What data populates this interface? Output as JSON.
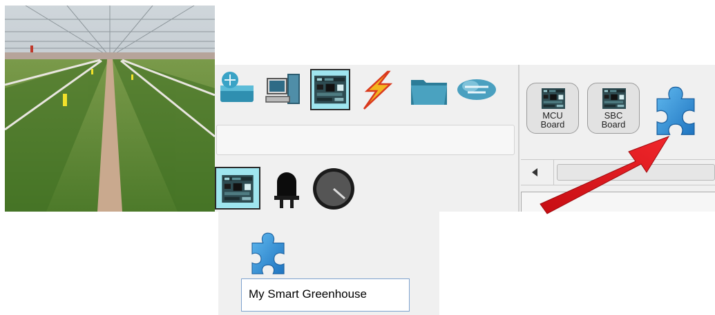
{
  "photo": {
    "name": "greenhouse-photo"
  },
  "toolbar": {
    "category_icons": [
      {
        "name": "network-devices-icon",
        "selected": false
      },
      {
        "name": "end-devices-icon",
        "selected": false
      },
      {
        "name": "components-board-icon",
        "selected": true
      },
      {
        "name": "connections-lightning-icon",
        "selected": false
      },
      {
        "name": "miscellaneous-folder-icon",
        "selected": false
      },
      {
        "name": "multiuser-cloud-icon",
        "selected": false
      }
    ],
    "search_value": "",
    "sub_icons": [
      {
        "name": "board-icon",
        "selected": true
      },
      {
        "name": "led-icon",
        "selected": false
      },
      {
        "name": "potentiometer-icon",
        "selected": false
      }
    ]
  },
  "devices": {
    "mcu_board": {
      "line1": "MCU",
      "line2": "Board"
    },
    "sbc_board": {
      "line1": "SBC",
      "line2": "Board"
    },
    "custom_icon": "puzzle-piece-icon"
  },
  "custom_device": {
    "icon": "puzzle-piece-icon",
    "name_value": "My Smart Greenhouse"
  },
  "colors": {
    "selection_bg": "#9fe5ef",
    "puzzle_blue": "#2e8fd4",
    "arrow_red": "#e0141b",
    "panel_bg": "#f0f0f0"
  }
}
